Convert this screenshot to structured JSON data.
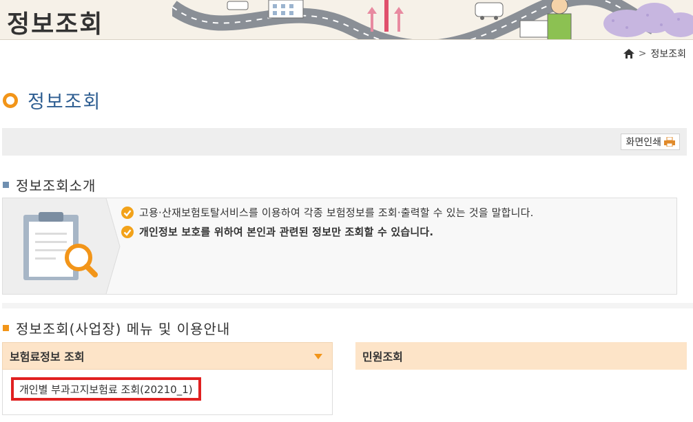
{
  "banner": {
    "title": "정보조회"
  },
  "breadcrumb": {
    "current": "정보조회"
  },
  "page": {
    "title": "정보조회"
  },
  "toolbar": {
    "print_label": "화면인쇄"
  },
  "intro": {
    "heading": "정보조회소개",
    "lines": [
      "고용·산재보험토탈서비스를 이용하여 각종 보험정보를 조회·출력할 수 있는 것을 말합니다.",
      "개인정보 보호를 위하여 본인과 관련된 정보만 조회할 수 있습니다."
    ]
  },
  "menu_section": {
    "heading": "정보조회(사업장) 메뉴 및 이용안내",
    "panels": [
      {
        "title": "보험료정보 조회",
        "items": [
          "개인별 부과고지보험료 조회(20210_1)"
        ]
      },
      {
        "title": "민원조회",
        "items": []
      }
    ]
  },
  "colors": {
    "accent_orange": "#f29519",
    "title_blue": "#2d5d91",
    "panel_header": "#fde4c8",
    "highlight_red": "#e02020"
  },
  "icons": [
    "home-icon",
    "printer-icon",
    "check-icon",
    "caret-down-icon",
    "clipboard-magnifier-icon"
  ]
}
